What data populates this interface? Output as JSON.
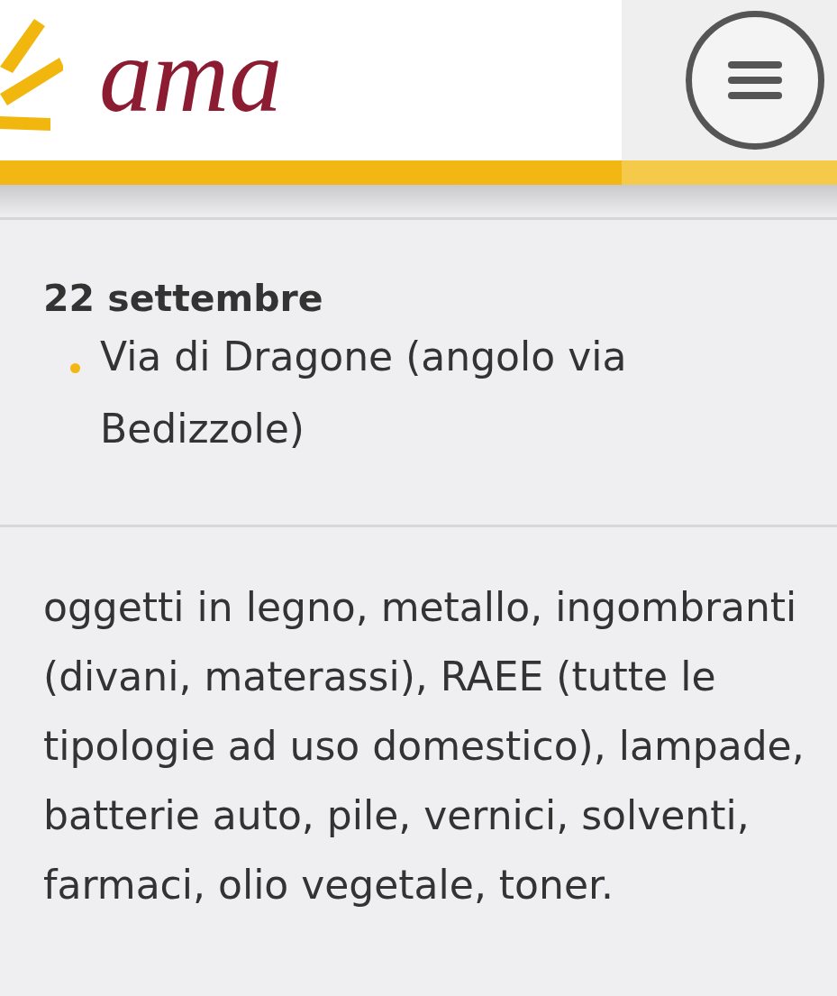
{
  "header": {
    "logo_text": "ama"
  },
  "date": "22 settembre",
  "locations": [
    "Via di Dragone (angolo via Bedizzole)"
  ],
  "description": "oggetti in legno, metallo, ingombranti (divani, materassi), RAEE (tutte le tipologie ad uso domestico), lampade, batterie auto, pile, vernici, solventi,\nfarmaci, olio vegetale, toner."
}
